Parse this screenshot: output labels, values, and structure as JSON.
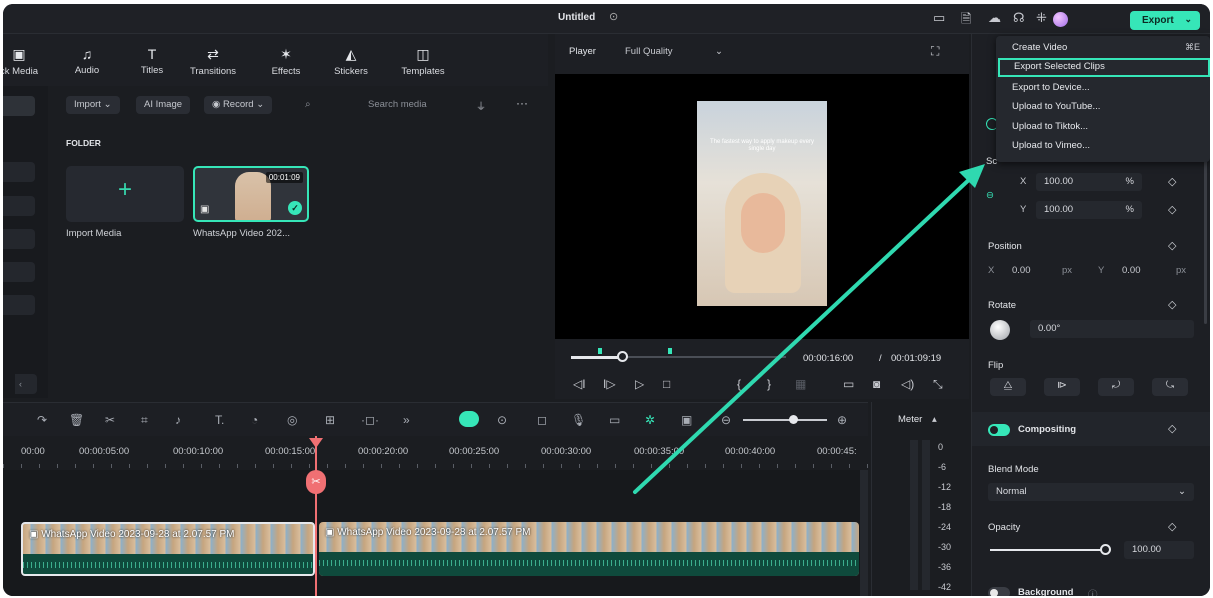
{
  "window": {
    "title": "Untitled"
  },
  "toolbar": {
    "export_label": "Export",
    "tools": [
      {
        "label": "ck Media",
        "icon": "media-icon"
      },
      {
        "label": "Audio",
        "icon": "music-note-icon"
      },
      {
        "label": "Titles",
        "icon": "text-icon"
      },
      {
        "label": "Transitions",
        "icon": "transition-icon"
      },
      {
        "label": "Effects",
        "icon": "sparkle-icon"
      },
      {
        "label": "Stickers",
        "icon": "sticker-icon"
      },
      {
        "label": "Templates",
        "icon": "template-icon"
      }
    ]
  },
  "media": {
    "import_label": "Import",
    "ai_image_label": "AI Image",
    "record_label": "Record",
    "search_placeholder": "Search media",
    "folder_label": "FOLDER",
    "import_media_label": "Import Media",
    "clip_name": "WhatsApp Video 202...",
    "clip_duration": "00:01:09"
  },
  "player": {
    "tab_label": "Player",
    "quality_label": "Full Quality",
    "current_time": "00:00:16:00",
    "separator": "/",
    "total_time": "00:01:09:19",
    "video_caption": "The fastest way to apply makeup every single day"
  },
  "export_menu": {
    "items": [
      {
        "label": "Create Video",
        "shortcut": "⌘E"
      },
      {
        "label": "Export Selected Clips",
        "shortcut": ""
      },
      {
        "label": "Export to Device...",
        "shortcut": ""
      },
      {
        "label": "Upload to YouTube...",
        "shortcut": ""
      },
      {
        "label": "Upload to Tiktok...",
        "shortcut": ""
      },
      {
        "label": "Upload to Vimeo...",
        "shortcut": ""
      }
    ],
    "selected_index": 1
  },
  "properties": {
    "scale_label": "Sc",
    "scale_x_label": "X",
    "scale_x": "100.00",
    "scale_y_label": "Y",
    "scale_y": "100.00",
    "percent": "%",
    "position_label": "Position",
    "pos_x_label": "X",
    "pos_x": "0.00",
    "pos_y_label": "Y",
    "pos_y": "0.00",
    "px": "px",
    "rotate_label": "Rotate",
    "rotate_value": "0.00°",
    "flip_label": "Flip",
    "compositing_label": "Compositing",
    "blend_mode_label": "Blend Mode",
    "blend_mode_value": "Normal",
    "opacity_label": "Opacity",
    "opacity_value": "100.00",
    "background_label": "Background"
  },
  "timeline": {
    "ruler": [
      "00:00",
      "00:00:05:00",
      "00:00:10:00",
      "00:00:15:00",
      "00:00:20:00",
      "00:00:25:00",
      "00:00:30:00",
      "00:00:35:00",
      "00:00:40:00",
      "00:00:45:"
    ],
    "clip_label": "WhatsApp Video 2023-09-28 at 2.07.57 PM",
    "meter_label": "Meter",
    "meter_scale": [
      "0",
      "-6",
      "-12",
      "-18",
      "-24",
      "-30",
      "-36",
      "-42"
    ]
  },
  "colors": {
    "accent": "#36e6b8",
    "playhead": "#f07073",
    "background": "#1b1d21"
  }
}
